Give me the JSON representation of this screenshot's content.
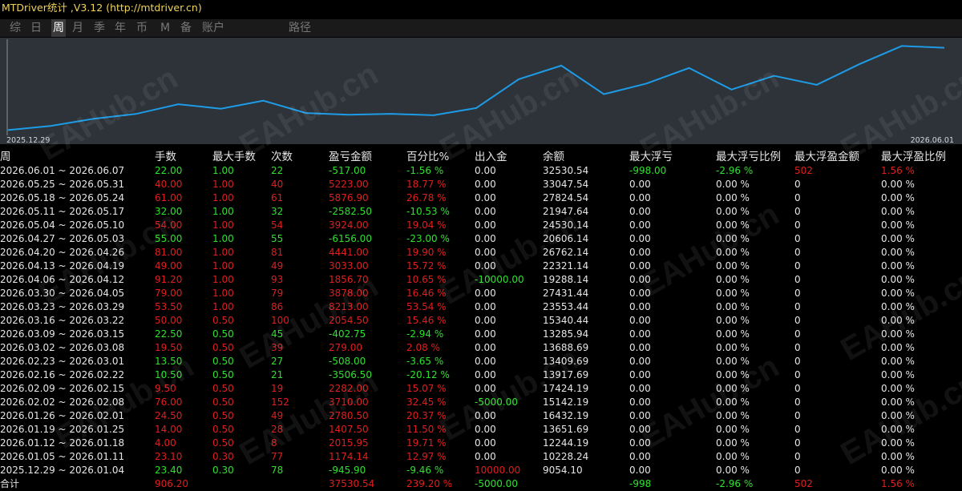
{
  "window": {
    "title": "MTDriver统计 ,V3.12 (http://mtdriver.cn)"
  },
  "tabs": [
    {
      "label": "综",
      "active": false
    },
    {
      "label": "日",
      "active": false
    },
    {
      "label": "周",
      "active": true
    },
    {
      "label": "月",
      "active": false
    },
    {
      "label": "季",
      "active": false
    },
    {
      "label": "年",
      "active": false
    },
    {
      "label": "币",
      "active": false
    },
    {
      "label": "M",
      "active": false
    },
    {
      "label": "备",
      "active": false
    },
    {
      "label": "账户",
      "active": false
    },
    {
      "label": "路径",
      "active": false
    }
  ],
  "chart": {
    "start_label": "2025.12.29",
    "end_label": "2026.06.01",
    "line_color": "#1e9be6",
    "balance_series": [
      9054.1,
      10228.24,
      12244.19,
      13651.69,
      16432.19,
      15142.19,
      17424.19,
      13917.69,
      13409.69,
      13688.69,
      13285.94,
      15340.44,
      23553.44,
      27431.44,
      19288.14,
      22321.14,
      26762.14,
      20606.14,
      24530.14,
      21947.64,
      27824.54,
      33047.54,
      32530.54
    ]
  },
  "table": {
    "headers": [
      "周",
      "手数",
      "最大手数",
      "次数",
      "盈亏金额",
      "百分比%",
      "出入金",
      "余额",
      "最大浮亏",
      "最大浮亏比例",
      "最大浮盈金额",
      "最大浮盈比例"
    ],
    "rows": [
      {
        "period": "2026.06.01 ~ 2026.06.07",
        "lots": "22.00",
        "max_lots": "1.00",
        "count": "22",
        "pnl": "-517.00",
        "pct": "-1.56 %",
        "deposit": "0.00",
        "balance": "32530.54",
        "max_dd": "-998.00",
        "max_dd_pct": "-2.96 %",
        "max_fp": "502",
        "max_fp_pct": "1.56 %",
        "profit": false,
        "dd_neg": true,
        "fp_pos": true,
        "dep_sign": "zero"
      },
      {
        "period": "2026.05.25 ~ 2026.05.31",
        "lots": "40.00",
        "max_lots": "1.00",
        "count": "40",
        "pnl": "5223.00",
        "pct": "18.77 %",
        "deposit": "0.00",
        "balance": "33047.54",
        "max_dd": "0.00",
        "max_dd_pct": "0.00 %",
        "max_fp": "0",
        "max_fp_pct": "0.00 %",
        "profit": true,
        "dd_neg": false,
        "fp_pos": false,
        "dep_sign": "zero"
      },
      {
        "period": "2026.05.18 ~ 2026.05.24",
        "lots": "61.00",
        "max_lots": "1.00",
        "count": "61",
        "pnl": "5876.90",
        "pct": "26.78 %",
        "deposit": "0.00",
        "balance": "27824.54",
        "max_dd": "0.00",
        "max_dd_pct": "0.00 %",
        "max_fp": "0",
        "max_fp_pct": "0.00 %",
        "profit": true,
        "dd_neg": false,
        "fp_pos": false,
        "dep_sign": "zero"
      },
      {
        "period": "2026.05.11 ~ 2026.05.17",
        "lots": "32.00",
        "max_lots": "1.00",
        "count": "32",
        "pnl": "-2582.50",
        "pct": "-10.53 %",
        "deposit": "0.00",
        "balance": "21947.64",
        "max_dd": "0.00",
        "max_dd_pct": "0.00 %",
        "max_fp": "0",
        "max_fp_pct": "0.00 %",
        "profit": false,
        "dd_neg": false,
        "fp_pos": false,
        "dep_sign": "zero"
      },
      {
        "period": "2026.05.04 ~ 2026.05.10",
        "lots": "54.00",
        "max_lots": "1.00",
        "count": "54",
        "pnl": "3924.00",
        "pct": "19.04 %",
        "deposit": "0.00",
        "balance": "24530.14",
        "max_dd": "0.00",
        "max_dd_pct": "0.00 %",
        "max_fp": "0",
        "max_fp_pct": "0.00 %",
        "profit": true,
        "dd_neg": false,
        "fp_pos": false,
        "dep_sign": "zero"
      },
      {
        "period": "2026.04.27 ~ 2026.05.03",
        "lots": "55.00",
        "max_lots": "1.00",
        "count": "55",
        "pnl": "-6156.00",
        "pct": "-23.00 %",
        "deposit": "0.00",
        "balance": "20606.14",
        "max_dd": "0.00",
        "max_dd_pct": "0.00 %",
        "max_fp": "0",
        "max_fp_pct": "0.00 %",
        "profit": false,
        "dd_neg": false,
        "fp_pos": false,
        "dep_sign": "zero"
      },
      {
        "period": "2026.04.20 ~ 2026.04.26",
        "lots": "81.00",
        "max_lots": "1.00",
        "count": "81",
        "pnl": "4441.00",
        "pct": "19.90 %",
        "deposit": "0.00",
        "balance": "26762.14",
        "max_dd": "0.00",
        "max_dd_pct": "0.00 %",
        "max_fp": "0",
        "max_fp_pct": "0.00 %",
        "profit": true,
        "dd_neg": false,
        "fp_pos": false,
        "dep_sign": "zero"
      },
      {
        "period": "2026.04.13 ~ 2026.04.19",
        "lots": "49.00",
        "max_lots": "1.00",
        "count": "49",
        "pnl": "3033.00",
        "pct": "15.72 %",
        "deposit": "0.00",
        "balance": "22321.14",
        "max_dd": "0.00",
        "max_dd_pct": "0.00 %",
        "max_fp": "0",
        "max_fp_pct": "0.00 %",
        "profit": true,
        "dd_neg": false,
        "fp_pos": false,
        "dep_sign": "zero"
      },
      {
        "period": "2026.04.06 ~ 2026.04.12",
        "lots": "91.20",
        "max_lots": "1.00",
        "count": "93",
        "pnl": "1856.70",
        "pct": "10.65 %",
        "deposit": "-10000.00",
        "balance": "19288.14",
        "max_dd": "0.00",
        "max_dd_pct": "0.00 %",
        "max_fp": "0",
        "max_fp_pct": "0.00 %",
        "profit": true,
        "dd_neg": false,
        "fp_pos": false,
        "dep_sign": "neg"
      },
      {
        "period": "2026.03.30 ~ 2026.04.05",
        "lots": "79.00",
        "max_lots": "1.00",
        "count": "79",
        "pnl": "3878.00",
        "pct": "16.46 %",
        "deposit": "0.00",
        "balance": "27431.44",
        "max_dd": "0.00",
        "max_dd_pct": "0.00 %",
        "max_fp": "0",
        "max_fp_pct": "0.00 %",
        "profit": true,
        "dd_neg": false,
        "fp_pos": false,
        "dep_sign": "zero"
      },
      {
        "period": "2026.03.23 ~ 2026.03.29",
        "lots": "53.50",
        "max_lots": "1.00",
        "count": "86",
        "pnl": "8213.00",
        "pct": "53.54 %",
        "deposit": "0.00",
        "balance": "23553.44",
        "max_dd": "0.00",
        "max_dd_pct": "0.00 %",
        "max_fp": "0",
        "max_fp_pct": "0.00 %",
        "profit": true,
        "dd_neg": false,
        "fp_pos": false,
        "dep_sign": "zero"
      },
      {
        "period": "2026.03.16 ~ 2026.03.22",
        "lots": "50.00",
        "max_lots": "0.50",
        "count": "100",
        "pnl": "2054.50",
        "pct": "15.46 %",
        "deposit": "0.00",
        "balance": "15340.44",
        "max_dd": "0.00",
        "max_dd_pct": "0.00 %",
        "max_fp": "0",
        "max_fp_pct": "0.00 %",
        "profit": true,
        "dd_neg": false,
        "fp_pos": false,
        "dep_sign": "zero"
      },
      {
        "period": "2026.03.09 ~ 2026.03.15",
        "lots": "22.50",
        "max_lots": "0.50",
        "count": "45",
        "pnl": "-402.75",
        "pct": "-2.94 %",
        "deposit": "0.00",
        "balance": "13285.94",
        "max_dd": "0.00",
        "max_dd_pct": "0.00 %",
        "max_fp": "0",
        "max_fp_pct": "0.00 %",
        "profit": false,
        "dd_neg": false,
        "fp_pos": false,
        "dep_sign": "zero"
      },
      {
        "period": "2026.03.02 ~ 2026.03.08",
        "lots": "19.50",
        "max_lots": "0.50",
        "count": "39",
        "pnl": "279.00",
        "pct": "2.08 %",
        "deposit": "0.00",
        "balance": "13688.69",
        "max_dd": "0.00",
        "max_dd_pct": "0.00 %",
        "max_fp": "0",
        "max_fp_pct": "0.00 %",
        "profit": true,
        "dd_neg": false,
        "fp_pos": false,
        "dep_sign": "zero"
      },
      {
        "period": "2026.02.23 ~ 2026.03.01",
        "lots": "13.50",
        "max_lots": "0.50",
        "count": "27",
        "pnl": "-508.00",
        "pct": "-3.65 %",
        "deposit": "0.00",
        "balance": "13409.69",
        "max_dd": "0.00",
        "max_dd_pct": "0.00 %",
        "max_fp": "0",
        "max_fp_pct": "0.00 %",
        "profit": false,
        "dd_neg": false,
        "fp_pos": false,
        "dep_sign": "zero"
      },
      {
        "period": "2026.02.16 ~ 2026.02.22",
        "lots": "10.50",
        "max_lots": "0.50",
        "count": "21",
        "pnl": "-3506.50",
        "pct": "-20.12 %",
        "deposit": "0.00",
        "balance": "13917.69",
        "max_dd": "0.00",
        "max_dd_pct": "0.00 %",
        "max_fp": "0",
        "max_fp_pct": "0.00 %",
        "profit": false,
        "dd_neg": false,
        "fp_pos": false,
        "dep_sign": "zero"
      },
      {
        "period": "2026.02.09 ~ 2026.02.15",
        "lots": "9.50",
        "max_lots": "0.50",
        "count": "19",
        "pnl": "2282.00",
        "pct": "15.07 %",
        "deposit": "0.00",
        "balance": "17424.19",
        "max_dd": "0.00",
        "max_dd_pct": "0.00 %",
        "max_fp": "0",
        "max_fp_pct": "0.00 %",
        "profit": true,
        "dd_neg": false,
        "fp_pos": false,
        "dep_sign": "zero"
      },
      {
        "period": "2026.02.02 ~ 2026.02.08",
        "lots": "76.00",
        "max_lots": "0.50",
        "count": "152",
        "pnl": "3710.00",
        "pct": "32.45 %",
        "deposit": "-5000.00",
        "balance": "15142.19",
        "max_dd": "0.00",
        "max_dd_pct": "0.00 %",
        "max_fp": "0",
        "max_fp_pct": "0.00 %",
        "profit": true,
        "dd_neg": false,
        "fp_pos": false,
        "dep_sign": "neg"
      },
      {
        "period": "2026.01.26 ~ 2026.02.01",
        "lots": "24.50",
        "max_lots": "0.50",
        "count": "49",
        "pnl": "2780.50",
        "pct": "20.37 %",
        "deposit": "0.00",
        "balance": "16432.19",
        "max_dd": "0.00",
        "max_dd_pct": "0.00 %",
        "max_fp": "0",
        "max_fp_pct": "0.00 %",
        "profit": true,
        "dd_neg": false,
        "fp_pos": false,
        "dep_sign": "zero"
      },
      {
        "period": "2026.01.19 ~ 2026.01.25",
        "lots": "14.00",
        "max_lots": "0.50",
        "count": "28",
        "pnl": "1407.50",
        "pct": "11.50 %",
        "deposit": "0.00",
        "balance": "13651.69",
        "max_dd": "0.00",
        "max_dd_pct": "0.00 %",
        "max_fp": "0",
        "max_fp_pct": "0.00 %",
        "profit": true,
        "dd_neg": false,
        "fp_pos": false,
        "dep_sign": "zero"
      },
      {
        "period": "2026.01.12 ~ 2026.01.18",
        "lots": "4.00",
        "max_lots": "0.50",
        "count": "8",
        "pnl": "2015.95",
        "pct": "19.71 %",
        "deposit": "0.00",
        "balance": "12244.19",
        "max_dd": "0.00",
        "max_dd_pct": "0.00 %",
        "max_fp": "0",
        "max_fp_pct": "0.00 %",
        "profit": true,
        "dd_neg": false,
        "fp_pos": false,
        "dep_sign": "zero"
      },
      {
        "period": "2026.01.05 ~ 2026.01.11",
        "lots": "23.10",
        "max_lots": "0.30",
        "count": "77",
        "pnl": "1174.14",
        "pct": "12.97 %",
        "deposit": "0.00",
        "balance": "10228.24",
        "max_dd": "0.00",
        "max_dd_pct": "0.00 %",
        "max_fp": "0",
        "max_fp_pct": "0.00 %",
        "profit": true,
        "dd_neg": false,
        "fp_pos": false,
        "dep_sign": "zero"
      },
      {
        "period": "2025.12.29 ~ 2026.01.04",
        "lots": "23.40",
        "max_lots": "0.30",
        "count": "78",
        "pnl": "-945.90",
        "pct": "-9.46 %",
        "deposit": "10000.00",
        "balance": "9054.10",
        "max_dd": "0.00",
        "max_dd_pct": "0.00 %",
        "max_fp": "0",
        "max_fp_pct": "0.00 %",
        "profit": false,
        "dd_neg": false,
        "fp_pos": false,
        "dep_sign": "pos"
      }
    ],
    "total": {
      "label": "合计",
      "lots": "906.20",
      "pnl": "37530.54",
      "pct": "239.20 %",
      "deposit": "-5000.00",
      "max_dd": "-998",
      "max_dd_pct": "-2.96 %",
      "max_fp": "502",
      "max_fp_pct": "1.56 %"
    }
  },
  "watermark": "EAHub.cn",
  "colors": {
    "profit": "#e01e1e",
    "loss": "#2ee02e",
    "neutral": "#e6e6e6",
    "title": "#f0d35a",
    "chart_bg": "#2d3338"
  }
}
